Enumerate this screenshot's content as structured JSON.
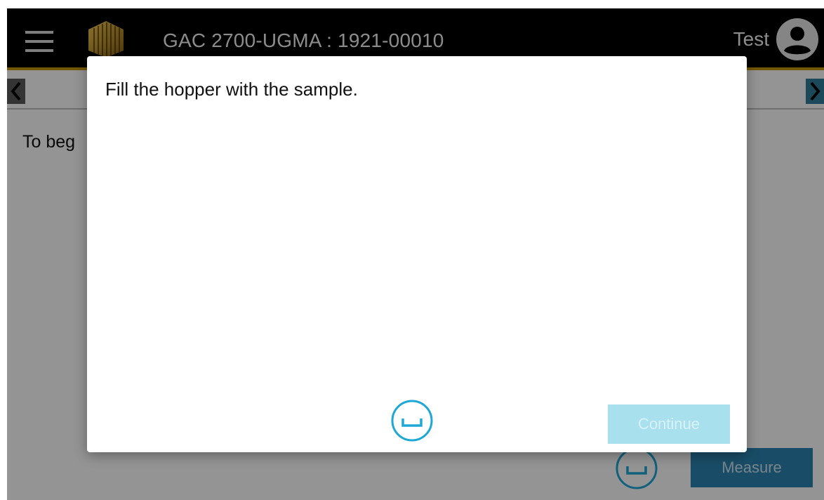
{
  "appbar": {
    "title": "GAC 2700-UGMA : 1921-00010",
    "user": "Test"
  },
  "icons": {
    "menu": "menu-icon",
    "logo": "gac-logo",
    "user": "account-circle-icon",
    "prev": "chevron-left-icon",
    "next": "chevron-right-icon",
    "keyboard_space": "spacebar-icon"
  },
  "main": {
    "intro_text": "To beg",
    "measure_label": "Measure"
  },
  "dialog": {
    "message": "Fill the hopper with the sample.",
    "continue_label": "Continue",
    "continue_enabled": false
  },
  "colors": {
    "accent_gold": "#c8960f",
    "primary_blue": "#2b86b2",
    "disabled_blue": "#a8e0ee",
    "spacebar_cyan": "#1ea8d6"
  }
}
